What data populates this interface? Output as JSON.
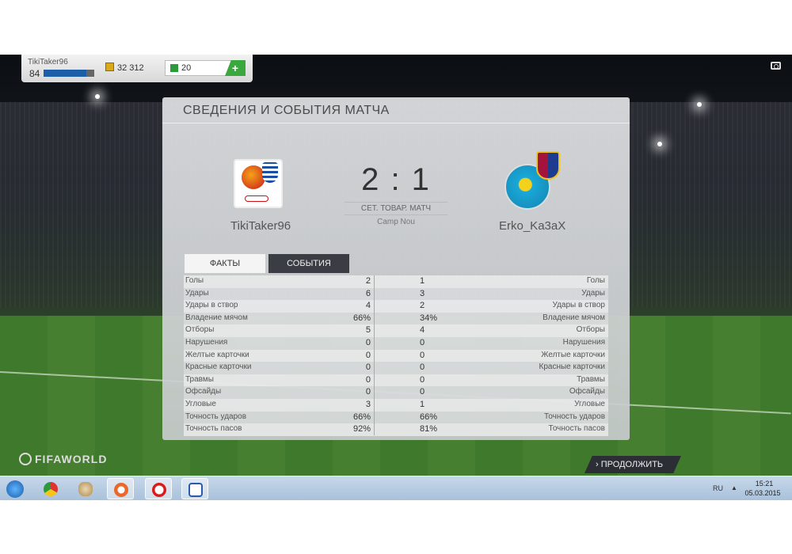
{
  "topbar": {
    "username": "TikiTaker96",
    "level": "84",
    "level_progress": 0.85,
    "coins": "32 312",
    "points": "20",
    "plus_label": "+"
  },
  "panel": {
    "title": "СВЕДЕНИЯ И СОБЫТИЯ МАТЧА",
    "home_name": "TikiTaker96",
    "away_name": "Erko_Ka3aX",
    "score": "2 : 1",
    "match_type": "СЕТ. ТОВАР. МАТЧ",
    "stadium": "Camp Nou",
    "tabs": [
      {
        "label": "ФАКТЫ",
        "active": true
      },
      {
        "label": "СОБЫТИЯ",
        "active": false
      }
    ]
  },
  "stats": [
    {
      "label": "Голы",
      "home": "2",
      "away": "1"
    },
    {
      "label": "Удары",
      "home": "6",
      "away": "3"
    },
    {
      "label": "Удары в створ",
      "home": "4",
      "away": "2"
    },
    {
      "label": "Владение мячом",
      "home": "66%",
      "away": "34%"
    },
    {
      "label": "Отборы",
      "home": "5",
      "away": "4"
    },
    {
      "label": "Нарушения",
      "home": "0",
      "away": "0"
    },
    {
      "label": "Желтые карточки",
      "home": "0",
      "away": "0"
    },
    {
      "label": "Красные карточки",
      "home": "0",
      "away": "0"
    },
    {
      "label": "Травмы",
      "home": "0",
      "away": "0"
    },
    {
      "label": "Офсайды",
      "home": "0",
      "away": "0"
    },
    {
      "label": "Угловые",
      "home": "3",
      "away": "1"
    },
    {
      "label": "Точность ударов",
      "home": "66%",
      "away": "66%"
    },
    {
      "label": "Точность пасов",
      "home": "92%",
      "away": "81%"
    }
  ],
  "bottom": {
    "logo": "FIFAWORLD",
    "continue_label": "ПРОДОЛЖИТЬ"
  },
  "taskbar": {
    "lang": "RU",
    "time": "15:21",
    "date": "05.03.2015"
  }
}
